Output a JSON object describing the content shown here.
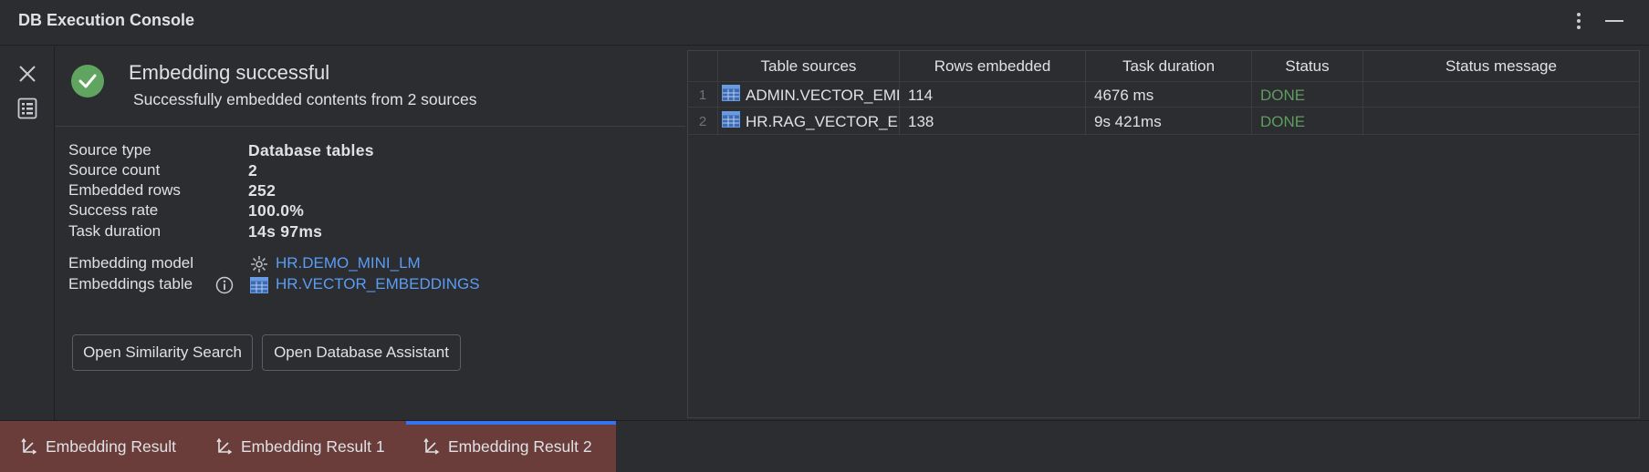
{
  "window": {
    "title": "DB Execution Console"
  },
  "summary": {
    "title": "Embedding successful",
    "subtitle": "Successfully embedded contents from 2 sources",
    "rows": [
      {
        "label": "Source type",
        "value": "Database tables"
      },
      {
        "label": "Source count",
        "value": "2"
      },
      {
        "label": "Embedded rows",
        "value": "252"
      },
      {
        "label": "Success rate",
        "value": "100.0%"
      },
      {
        "label": "Task duration",
        "value": "14s 97ms"
      }
    ],
    "embedding_model": {
      "label": "Embedding model",
      "value": "HR.DEMO_MINI_LM",
      "icon": "model-icon"
    },
    "embeddings_table": {
      "label": "Embeddings table",
      "value": "HR.VECTOR_EMBEDDINGS",
      "icon": "table-icon"
    },
    "buttons": {
      "similarity": "Open Similarity Search",
      "assistant": "Open Database Assistant"
    }
  },
  "table": {
    "columns": [
      "Table sources",
      "Rows embedded",
      "Task duration",
      "Status",
      "Status message"
    ],
    "rows": [
      {
        "num": "1",
        "source": "ADMIN.VECTOR_EMBEDDINGS",
        "rows": "114",
        "duration": "4676 ms",
        "status": "DONE",
        "message": ""
      },
      {
        "num": "2",
        "source": "HR.RAG_VECTOR_EMBEDDINGS",
        "rows": "138",
        "duration": "9s 421ms",
        "status": "DONE",
        "message": ""
      }
    ]
  },
  "tabs": [
    {
      "label": "Embedding Result"
    },
    {
      "label": "Embedding Result 1"
    },
    {
      "label": "Embedding Result 2"
    }
  ],
  "colors": {
    "accent": "#3574f0",
    "success": "#5fa45f",
    "link": "#5b9df5",
    "tab_bg": "#6a3d3a"
  }
}
